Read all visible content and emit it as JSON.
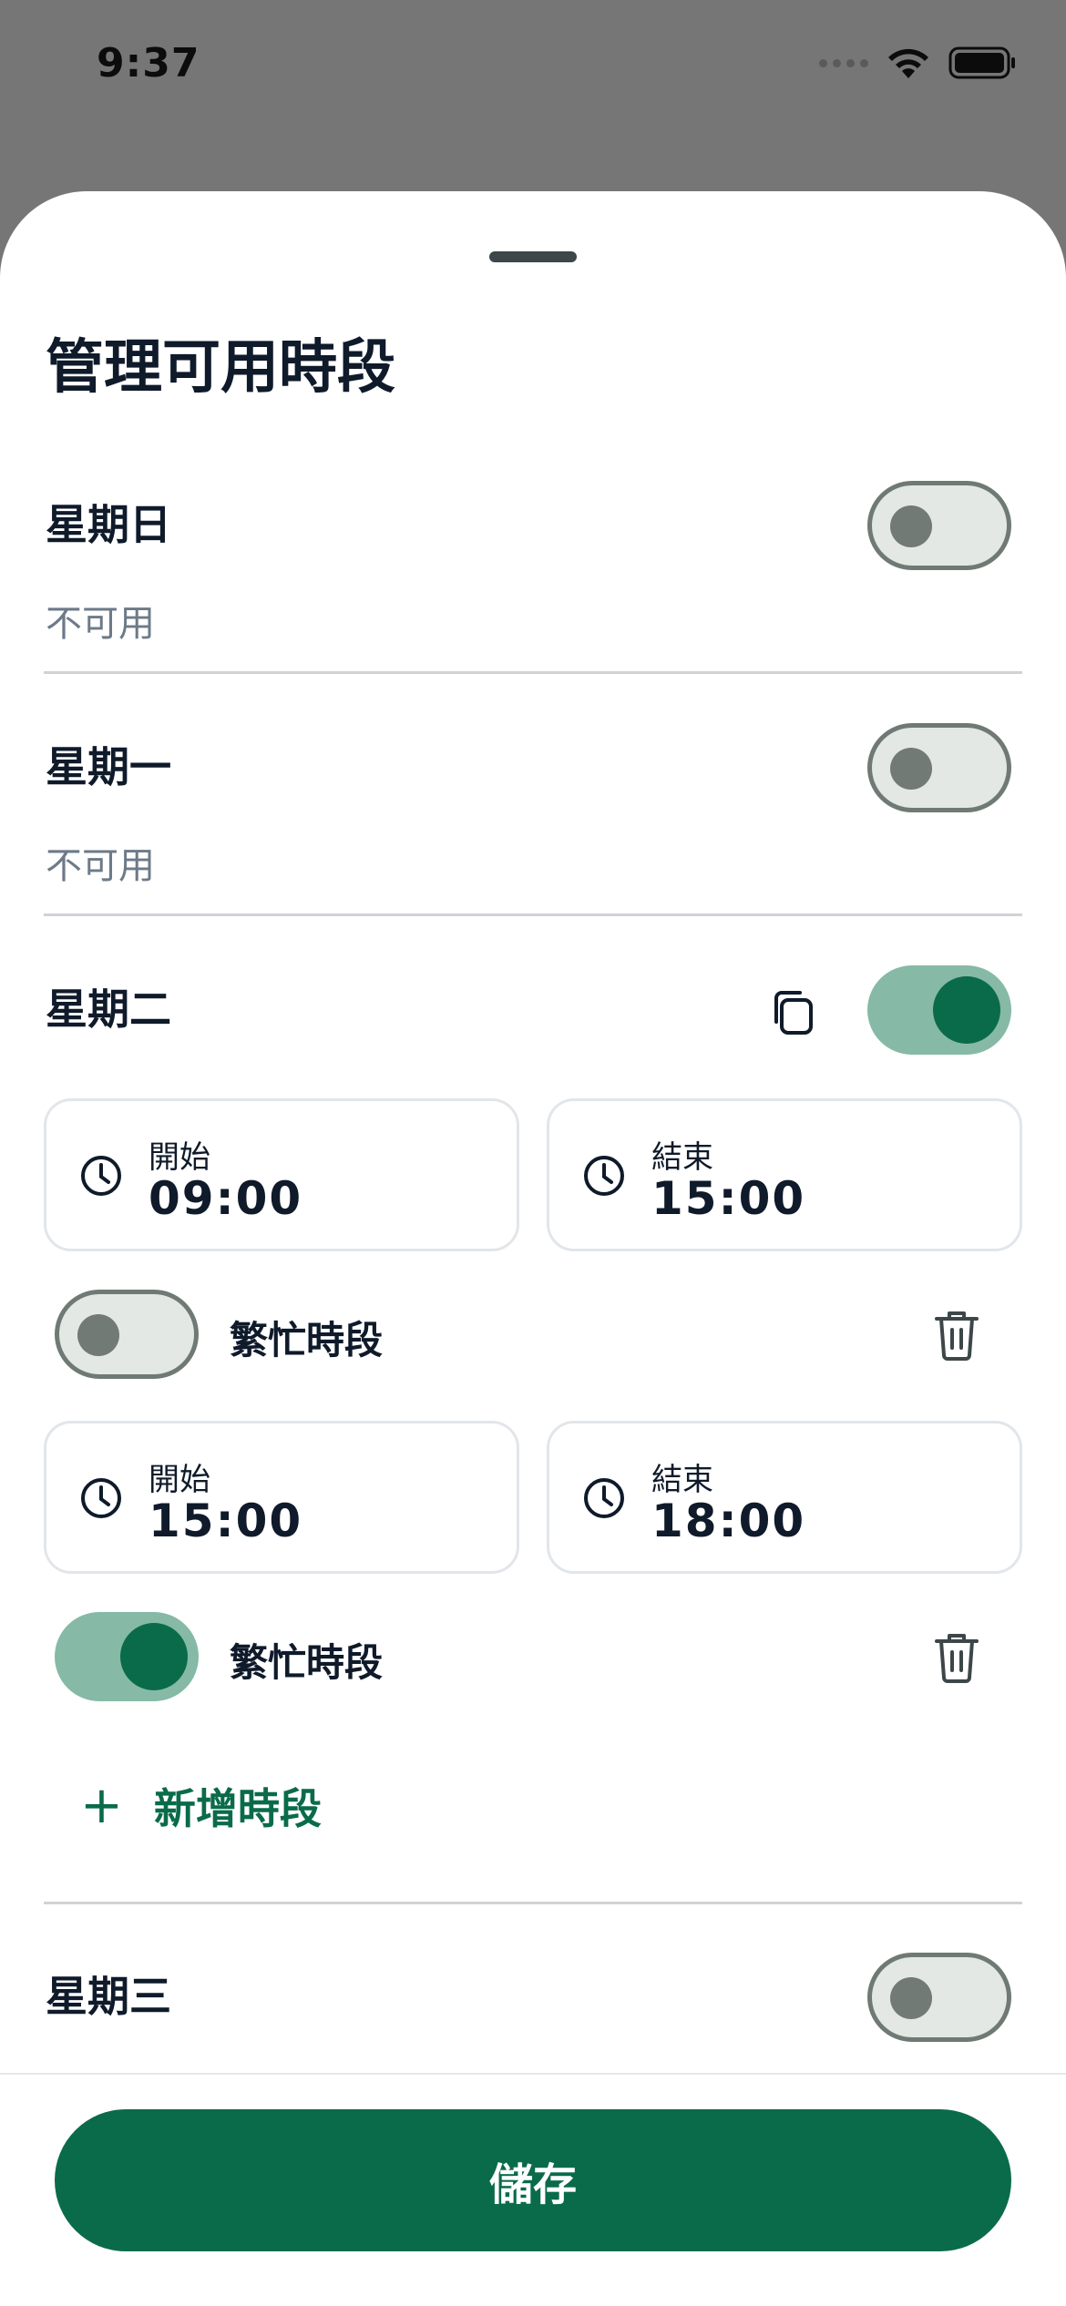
{
  "status_bar": {
    "time": "9:37"
  },
  "sheet": {
    "title": "管理可用時段"
  },
  "days": {
    "sunday": {
      "label": "星期日",
      "status": "不可用",
      "enabled": false
    },
    "monday": {
      "label": "星期一",
      "status": "不可用",
      "enabled": false
    },
    "tuesday": {
      "label": "星期二",
      "enabled": true,
      "slots": [
        {
          "start_label": "開始",
          "start": "09:00",
          "end_label": "結束",
          "end": "15:00",
          "busy_label": "繁忙時段",
          "busy": false
        },
        {
          "start_label": "開始",
          "start": "15:00",
          "end_label": "結束",
          "end": "18:00",
          "busy_label": "繁忙時段",
          "busy": true
        }
      ],
      "add_slot_label": "新增時段"
    },
    "wednesday": {
      "label": "星期三",
      "enabled": false
    }
  },
  "footer": {
    "save_label": "儲存"
  },
  "colors": {
    "accent": "#0a6b4b",
    "toggle_on_track": "#86b9a6",
    "toggle_off_track": "#e3e8e4",
    "muted_text": "#6d7a88"
  },
  "icons": [
    "wifi-icon",
    "battery-icon",
    "copy-icon",
    "clock-icon",
    "trash-icon",
    "plus-icon"
  ]
}
